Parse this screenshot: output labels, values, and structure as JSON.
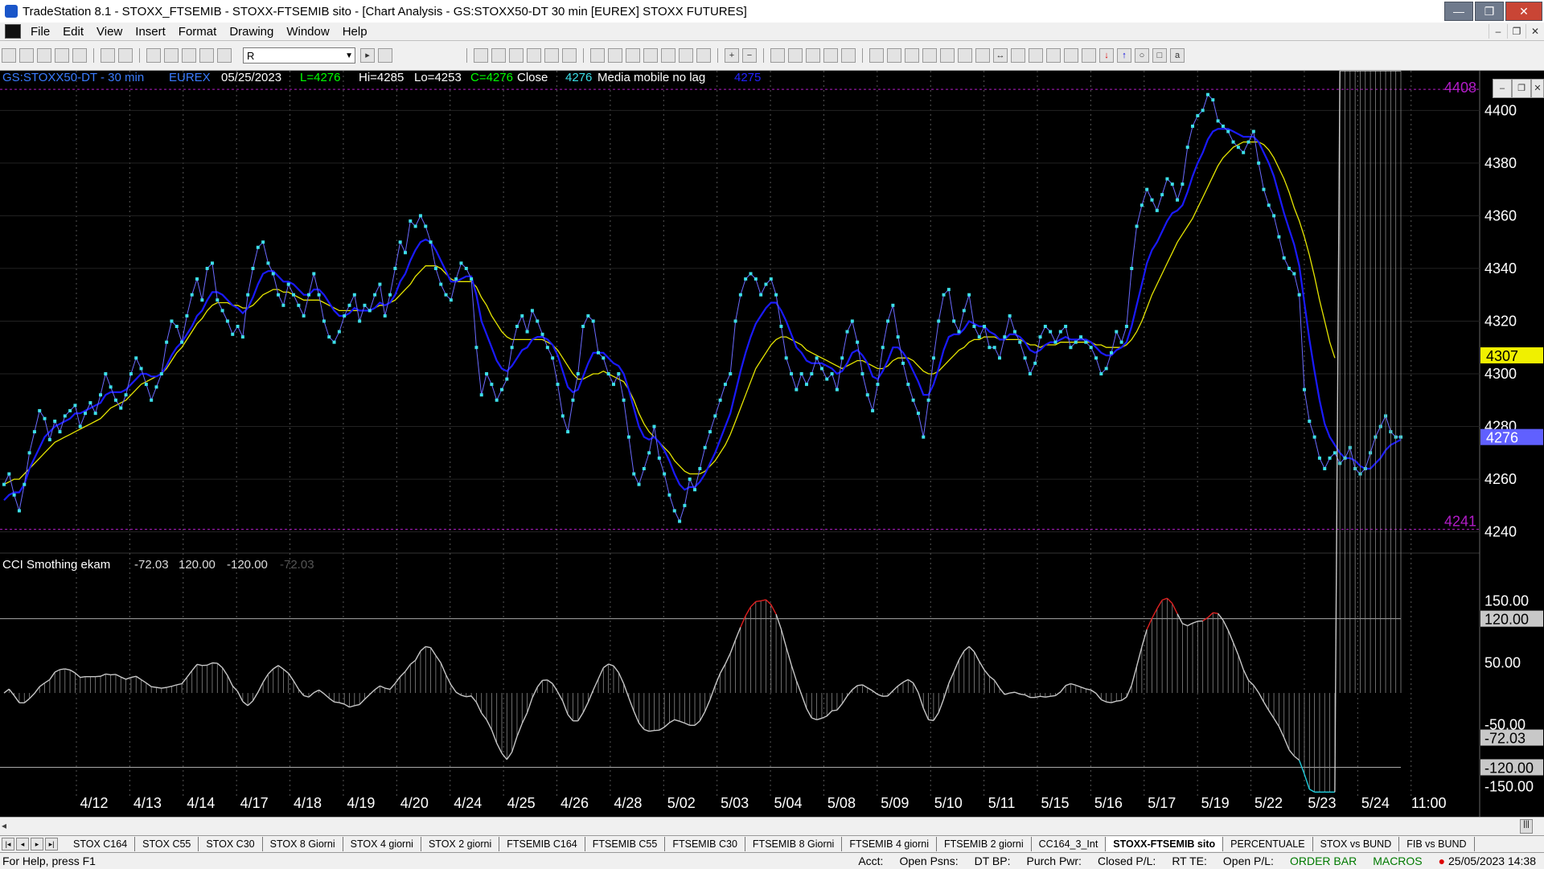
{
  "window": {
    "title": "TradeStation 8.1 - STOXX_FTSEMIB - STOXX-FTSEMIB sito - [Chart Analysis - GS:STOXX50-DT  30 min  [EUREX] STOXX FUTURES]",
    "minimize": "—",
    "restore": "❐",
    "close": "✕"
  },
  "menu": [
    "File",
    "Edit",
    "View",
    "Insert",
    "Format",
    "Drawing",
    "Window",
    "Help"
  ],
  "toolbar": {
    "symbol_value": "R"
  },
  "chart_header": {
    "symbol": "GS:STOXX50-DT - 30 min",
    "exchange": "EUREX",
    "date": "05/25/2023",
    "last": "L=4276",
    "high": "Hi=4285",
    "low": "Lo=4253",
    "close": "C=4276",
    "close_label": "Close",
    "close_value": "4276",
    "indicator_name": "Media mobile no lag",
    "indicator_value": "4275"
  },
  "colors": {
    "price": "#3cdfe8",
    "ma_fast": "#1a1aff",
    "ma_slow": "#e6e600",
    "osc": "#c8c8c8",
    "osc_hot": "#e02020",
    "osc_cold": "#20d0e0",
    "label_magenta": "#b21cc8",
    "grid": "#555555"
  },
  "price_axis": {
    "ticks": [
      "4400",
      "4380",
      "4360",
      "4340",
      "4320",
      "4300",
      "4280",
      "4260",
      "4240"
    ],
    "high_marker": "4408",
    "low_marker": "4241",
    "ma_marker": "4307",
    "price_marker": "4276"
  },
  "cci": {
    "name": "CCI Smothing ekam",
    "v1": "-72.03",
    "v2": "120.00",
    "v3": "-120.00",
    "v4": "-72.03",
    "ticks": [
      "150.00",
      "120.00",
      "50.00",
      "-50.00",
      "-72.03",
      "-120.00",
      "-150.00"
    ]
  },
  "x_axis": [
    "4/12",
    "4/13",
    "4/14",
    "4/17",
    "4/18",
    "4/19",
    "4/20",
    "4/24",
    "4/25",
    "4/26",
    "4/28",
    "5/02",
    "5/03",
    "5/04",
    "5/08",
    "5/09",
    "5/10",
    "5/11",
    "5/15",
    "5/16",
    "5/17",
    "5/19",
    "5/22",
    "5/23",
    "5/24",
    "11:00"
  ],
  "chart_data": {
    "type": "line",
    "title": "",
    "y_range": [
      4235,
      4412
    ],
    "day_boundaries": [
      "4/12",
      "4/13",
      "4/14",
      "4/17",
      "4/18",
      "4/19",
      "4/20",
      "4/24",
      "4/25",
      "4/26",
      "4/28",
      "5/02",
      "5/03",
      "5/04",
      "5/08",
      "5/09",
      "5/10",
      "5/11",
      "5/15",
      "5/16",
      "5/17",
      "5/19",
      "5/22",
      "5/23",
      "5/24",
      "11:00"
    ],
    "series": [
      {
        "values": [
          4258,
          4262,
          4254,
          4248,
          4258,
          4270,
          4278,
          4286,
          4283,
          4275,
          4282,
          4278,
          4284,
          4286,
          4288,
          4280,
          4285,
          4289,
          4285,
          4292,
          4300,
          4295,
          4290,
          4287,
          4292,
          4300,
          4306,
          4302,
          4296,
          4290,
          4295,
          4300,
          4312,
          4320,
          4318,
          4312,
          4322,
          4330,
          4336,
          4328,
          4340,
          4342,
          4328,
          4324,
          4320,
          4315,
          4318,
          4314,
          4330,
          4340,
          4348,
          4350,
          4342,
          4338,
          4330,
          4326,
          4334,
          4330,
          4326,
          4322,
          4330,
          4338,
          4330,
          4320,
          4314,
          4312,
          4316,
          4322,
          4326,
          4330,
          4320,
          4326,
          4324,
          4330,
          4334,
          4322,
          4330,
          4340,
          4350,
          4346,
          4358,
          4356,
          4360,
          4356,
          4350,
          4340,
          4334,
          4330,
          4328,
          4336,
          4342,
          4340,
          4336,
          4310,
          4292,
          4300,
          4296,
          4290,
          4294,
          4298,
          4310,
          4318,
          4322,
          4316,
          4324,
          4320,
          4315,
          4310,
          4306,
          4296,
          4284,
          4278,
          4290,
          4300,
          4318,
          4322,
          4320,
          4308,
          4306,
          4300,
          4296,
          4300,
          4290,
          4276,
          4262,
          4258,
          4264,
          4270,
          4280,
          4268,
          4262,
          4254,
          4248,
          4244,
          4250,
          4260,
          4256,
          4264,
          4272,
          4278,
          4284,
          4290,
          4296,
          4300,
          4320,
          4330,
          4336,
          4338,
          4336,
          4330,
          4334,
          4336,
          4330,
          4318,
          4306,
          4300,
          4294,
          4300,
          4296,
          4300,
          4306,
          4302,
          4298,
          4300,
          4294,
          4306,
          4316,
          4320,
          4312,
          4300,
          4292,
          4286,
          4296,
          4310,
          4320,
          4326,
          4314,
          4304,
          4296,
          4290,
          4285,
          4276,
          4290,
          4306,
          4320,
          4330,
          4332,
          4320,
          4316,
          4324,
          4330,
          4318,
          4314,
          4318,
          4310,
          4310,
          4306,
          4314,
          4322,
          4316,
          4312,
          4306,
          4300,
          4304,
          4314,
          4318,
          4316,
          4312,
          4316,
          4318,
          4310,
          4312,
          4314,
          4312,
          4310,
          4306,
          4300,
          4302,
          4308,
          4316,
          4312,
          4318,
          4340,
          4356,
          4364,
          4370,
          4366,
          4362,
          4368,
          4374,
          4372,
          4366,
          4372,
          4386,
          4394,
          4398,
          4400,
          4406,
          4404,
          4396,
          4394,
          4392,
          4388,
          4386,
          4384,
          4388,
          4392,
          4380,
          4370,
          4364,
          4360,
          4352,
          4344,
          4340,
          4338,
          4330,
          4294,
          4282,
          4276,
          4268,
          4264,
          4268,
          4270,
          4266,
          4268,
          4272,
          4264,
          4262,
          4264,
          4270,
          4276,
          4280,
          4284,
          4278,
          4276,
          4276
        ]
      },
      {
        "values": [
          4252,
          4254,
          4255,
          4255,
          4258,
          4264,
          4268,
          4272,
          4276,
          4278,
          4280,
          4281,
          4282,
          4283,
          4285,
          4285,
          4286,
          4287,
          4288,
          4289,
          4292,
          4293,
          4293,
          4293,
          4294,
          4296,
          4298,
          4300,
          4300,
          4299,
          4299,
          4300,
          4303,
          4307,
          4310,
          4312,
          4315,
          4318,
          4322,
          4324,
          4328,
          4331,
          4331,
          4330,
          4328,
          4326,
          4325,
          4323,
          4325,
          4329,
          4334,
          4338,
          4339,
          4339,
          4337,
          4335,
          4335,
          4334,
          4332,
          4330,
          4330,
          4332,
          4332,
          4330,
          4327,
          4324,
          4322,
          4322,
          4323,
          4325,
          4324,
          4324,
          4324,
          4325,
          4327,
          4326,
          4327,
          4330,
          4335,
          4338,
          4343,
          4347,
          4350,
          4351,
          4350,
          4347,
          4343,
          4339,
          4335,
          4335,
          4336,
          4337,
          4337,
          4330,
          4320,
          4315,
          4310,
          4305,
          4302,
          4301,
          4303,
          4306,
          4309,
          4310,
          4313,
          4314,
          4314,
          4313,
          4311,
          4307,
          4301,
          4295,
          4293,
          4294,
          4299,
          4304,
          4308,
          4308,
          4308,
          4306,
          4304,
          4303,
          4300,
          4294,
          4287,
          4280,
          4276,
          4275,
          4276,
          4274,
          4271,
          4267,
          4262,
          4258,
          4256,
          4257,
          4257,
          4259,
          4262,
          4266,
          4270,
          4275,
          4280,
          4285,
          4293,
          4301,
          4308,
          4314,
          4319,
          4322,
          4325,
          4327,
          4327,
          4324,
          4320,
          4315,
          4310,
          4308,
          4305,
          4304,
          4304,
          4304,
          4303,
          4302,
          4300,
          4301,
          4304,
          4308,
          4309,
          4307,
          4304,
          4299,
          4298,
          4301,
          4305,
          4310,
          4310,
          4308,
          4305,
          4301,
          4297,
          4292,
          4292,
          4296,
          4302,
          4309,
          4314,
          4315,
          4315,
          4317,
          4320,
          4319,
          4318,
          4318,
          4316,
          4315,
          4313,
          4313,
          4315,
          4315,
          4314,
          4312,
          4309,
          4308,
          4309,
          4311,
          4312,
          4312,
          4313,
          4314,
          4313,
          4313,
          4313,
          4313,
          4312,
          4310,
          4308,
          4307,
          4307,
          4309,
          4310,
          4312,
          4318,
          4326,
          4334,
          4342,
          4347,
          4350,
          4354,
          4358,
          4361,
          4362,
          4364,
          4369,
          4375,
          4380,
          4384,
          4389,
          4392,
          4393,
          4393,
          4393,
          4392,
          4391,
          4390,
          4390,
          4390,
          4388,
          4384,
          4380,
          4375,
          4368,
          4361,
          4355,
          4349,
          4341,
          4327,
          4313,
          4301,
          4290,
          4281,
          4276,
          4273,
          4270,
          4268,
          4268,
          4267,
          4265,
          4264,
          4264,
          4266,
          4268,
          4271,
          4273,
          4274,
          4275
        ]
      },
      {
        "values": [
          4258,
          4259,
          4260,
          4260,
          4262,
          4264,
          4266,
          4268,
          4270,
          4272,
          4274,
          4275,
          4276,
          4277,
          4278,
          4279,
          4280,
          4281,
          4282,
          4283,
          4285,
          4287,
          4288,
          4289,
          4290,
          4292,
          4294,
          4296,
          4297,
          4298,
          4299,
          4300,
          4302,
          4305,
          4308,
          4310,
          4313,
          4316,
          4319,
          4321,
          4324,
          4326,
          4327,
          4327,
          4327,
          4326,
          4326,
          4325,
          4325,
          4326,
          4328,
          4330,
          4331,
          4332,
          4332,
          4331,
          4331,
          4330,
          4329,
          4328,
          4328,
          4328,
          4328,
          4327,
          4326,
          4325,
          4324,
          4324,
          4324,
          4324,
          4324,
          4324,
          4324,
          4325,
          4326,
          4326,
          4327,
          4328,
          4330,
          4332,
          4334,
          4337,
          4339,
          4341,
          4341,
          4341,
          4340,
          4338,
          4336,
          4335,
          4335,
          4335,
          4335,
          4333,
          4329,
          4326,
          4322,
          4319,
          4316,
          4314,
          4313,
          4313,
          4313,
          4313,
          4313,
          4313,
          4313,
          4312,
          4311,
          4309,
          4306,
          4303,
          4300,
          4298,
          4298,
          4299,
          4300,
          4300,
          4301,
          4300,
          4299,
          4298,
          4297,
          4294,
          4290,
          4285,
          4281,
          4278,
          4276,
          4274,
          4272,
          4270,
          4267,
          4265,
          4263,
          4262,
          4262,
          4262,
          4263,
          4265,
          4267,
          4270,
          4273,
          4277,
          4282,
          4287,
          4292,
          4297,
          4302,
          4305,
          4308,
          4311,
          4313,
          4314,
          4314,
          4313,
          4312,
          4311,
          4309,
          4308,
          4307,
          4306,
          4305,
          4304,
          4303,
          4302,
          4303,
          4304,
          4305,
          4305,
          4304,
          4303,
          4302,
          4302,
          4303,
          4305,
          4306,
          4306,
          4306,
          4305,
          4303,
          4301,
          4300,
          4300,
          4301,
          4303,
          4305,
          4307,
          4309,
          4310,
          4312,
          4313,
          4313,
          4314,
          4314,
          4314,
          4313,
          4313,
          4313,
          4313,
          4313,
          4312,
          4311,
          4311,
          4310,
          4311,
          4311,
          4311,
          4312,
          4312,
          4312,
          4312,
          4312,
          4312,
          4312,
          4311,
          4311,
          4310,
          4310,
          4310,
          4310,
          4311,
          4313,
          4316,
          4320,
          4325,
          4330,
          4334,
          4338,
          4342,
          4346,
          4350,
          4353,
          4356,
          4359,
          4363,
          4367,
          4371,
          4375,
          4379,
          4382,
          4384,
          4386,
          4387,
          4388,
          4388,
          4388,
          4388,
          4387,
          4385,
          4382,
          4378,
          4374,
          4369,
          4363,
          4358,
          4352,
          4345,
          4337,
          4328,
          4320,
          4312,
          4306
        ]
      }
    ]
  }
}
